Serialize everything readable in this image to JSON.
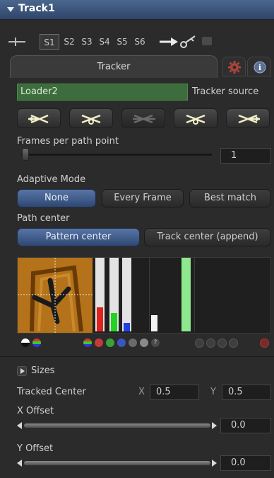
{
  "title": "Track1",
  "toolbar": {
    "tracks": [
      "S1",
      "S2",
      "S3",
      "S4",
      "S5",
      "S6"
    ],
    "selected": "S1"
  },
  "tabs": {
    "active": "Tracker",
    "icons": [
      "gear-icon",
      "info-icon"
    ]
  },
  "source": {
    "value": "Loader2",
    "label": "Tracker source"
  },
  "path_buttons": [
    "track-reverse-icon",
    "track-backward-icon",
    "stop-icon",
    "track-forward-icon",
    "track-forward-all-icon"
  ],
  "frames_per_path": {
    "label": "Frames per path point",
    "value": "1"
  },
  "adaptive": {
    "label": "Adaptive Mode",
    "options": [
      "None",
      "Every Frame",
      "Best match"
    ],
    "selected": "None"
  },
  "path_center": {
    "label": "Path center",
    "options": [
      "Pattern center",
      "Track center (append)"
    ],
    "selected": "Pattern center"
  },
  "channels": {
    "red": 0.33,
    "green": 0.25,
    "blue": 0.12,
    "luma": 0.22
  },
  "sizes": {
    "label": "Sizes"
  },
  "tracked_center": {
    "label": "Tracked Center",
    "x_label": "X",
    "x": "0.5",
    "y_label": "Y",
    "y": "0.5"
  },
  "x_offset": {
    "label": "X Offset",
    "value": "0.0"
  },
  "y_offset": {
    "label": "Y Offset",
    "value": "0.0"
  },
  "colors": {
    "accent": "#4b678e",
    "loader": "#3d6c3d",
    "red": "#e0221e",
    "green": "#22d322",
    "blue": "#2040e0"
  }
}
